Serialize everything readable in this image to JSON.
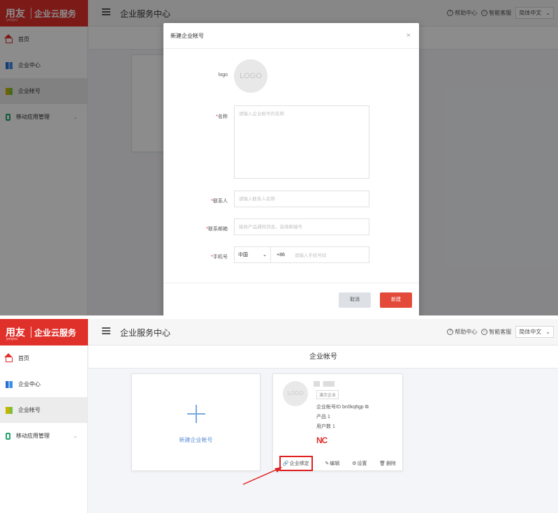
{
  "header": {
    "brand": "用友",
    "brand_sub": "yonyou",
    "product": "企业云服务",
    "page_title": "企业服务中心",
    "help": "帮助中心",
    "support": "智能客服",
    "language": "简体中文"
  },
  "sidebar": {
    "items": [
      {
        "label": "首页"
      },
      {
        "label": "企业中心"
      },
      {
        "label": "企业帐号"
      },
      {
        "label": "移动应用管理"
      }
    ]
  },
  "modal": {
    "title": "新建企业帐号",
    "logo_label": "logo",
    "logo_placeholder": "LOGO",
    "name_label": "名称",
    "name_placeholder": "请输入企业帐号的名称",
    "contact_label": "联系人",
    "contact_placeholder": "请输入联系人名称",
    "email_label": "联系邮箱",
    "email_placeholder": "接收产品通知消息，选填邮编号",
    "phone_label": "手机号",
    "country": "中国",
    "country_code": "+86",
    "phone_placeholder": "请输入手机号码",
    "cancel": "取消",
    "create": "新建"
  },
  "main": {
    "tab_title": "企业帐号",
    "new_account": "新建企业帐号",
    "account": {
      "logo_placeholder": "LOGO",
      "tag": "演示企业",
      "id_label": "企业帐号ID",
      "id_value": "bn0kq6gp",
      "product_label": "产品",
      "product_value": "1",
      "users_label": "用户数",
      "users_value": "1",
      "product_logo": "NC",
      "actions": {
        "bind": "企业绑定",
        "edit": "编辑",
        "settings": "设置",
        "delete": "删除"
      }
    }
  },
  "colors": {
    "brand_red": "#e0302a",
    "highlight_red": "#e02020",
    "link_blue": "#5b8fd6"
  }
}
